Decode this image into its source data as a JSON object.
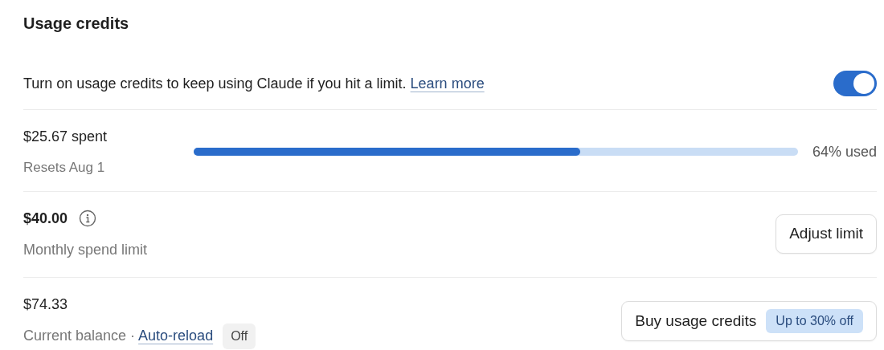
{
  "title": "Usage credits",
  "toggle_row": {
    "text": "Turn on usage credits to keep using Claude if you hit a limit.",
    "link": "Learn more",
    "on": true
  },
  "spend": {
    "amount": "$25.67 spent",
    "resets": "Resets Aug 1",
    "level": 0.64,
    "reading": "64% used"
  },
  "limit": {
    "amount": "$40.00",
    "label": "Monthly spend limit",
    "button": "Adjust limit"
  },
  "balance": {
    "amount": "$74.33",
    "label": "Current balance ·",
    "link": "Auto-reload",
    "status": "Off",
    "button": "Buy usage credits",
    "badge": "Up to 30% off"
  }
}
